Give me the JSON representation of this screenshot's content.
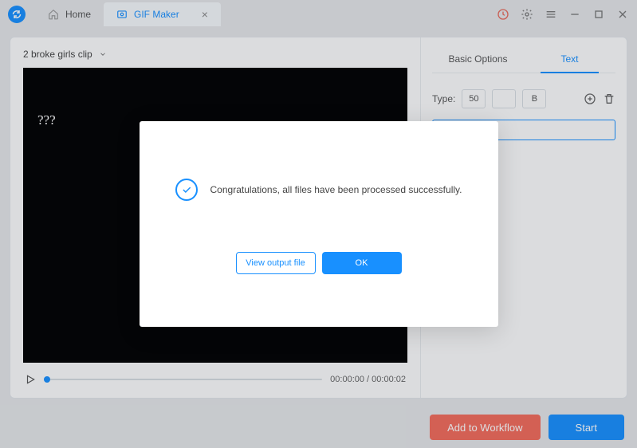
{
  "topbar": {
    "tabs": {
      "home": "Home",
      "active": "GIF Maker"
    }
  },
  "editor": {
    "filename": "2 broke girls clip",
    "overlay_text": "???",
    "time_current": "00:00:00",
    "time_total": "00:00:02"
  },
  "options": {
    "tab_basic": "Basic Options",
    "tab_text": "Text",
    "type_label": "Type:",
    "size_value": "50",
    "bold_label": "B"
  },
  "footer": {
    "workflow": "Add to Workflow",
    "start": "Start"
  },
  "dialog": {
    "message": "Congratulations, all files have been processed successfully.",
    "view_btn": "View output file",
    "ok_btn": "OK"
  }
}
